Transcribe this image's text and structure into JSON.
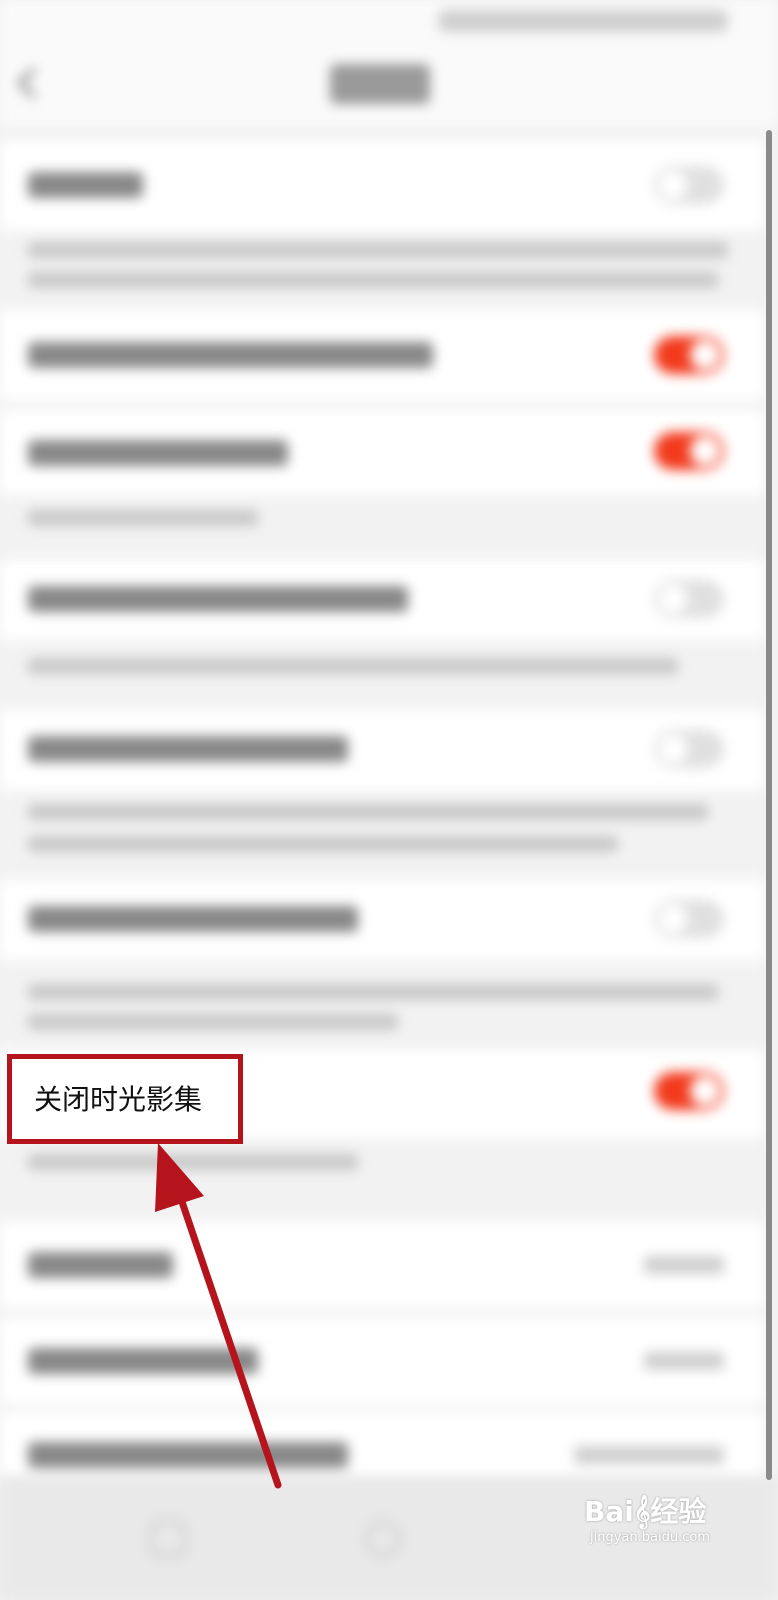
{
  "settings": {
    "highlighted_item": {
      "label": "关闭时光影集",
      "toggle_on": true
    }
  },
  "watermark": {
    "brand": "Bai𝄞经验",
    "url": "jingyan.baidu.com"
  },
  "colors": {
    "toggle_on": "#f23a1c",
    "highlight_border": "#b5141c",
    "arrow": "#b5141c"
  }
}
